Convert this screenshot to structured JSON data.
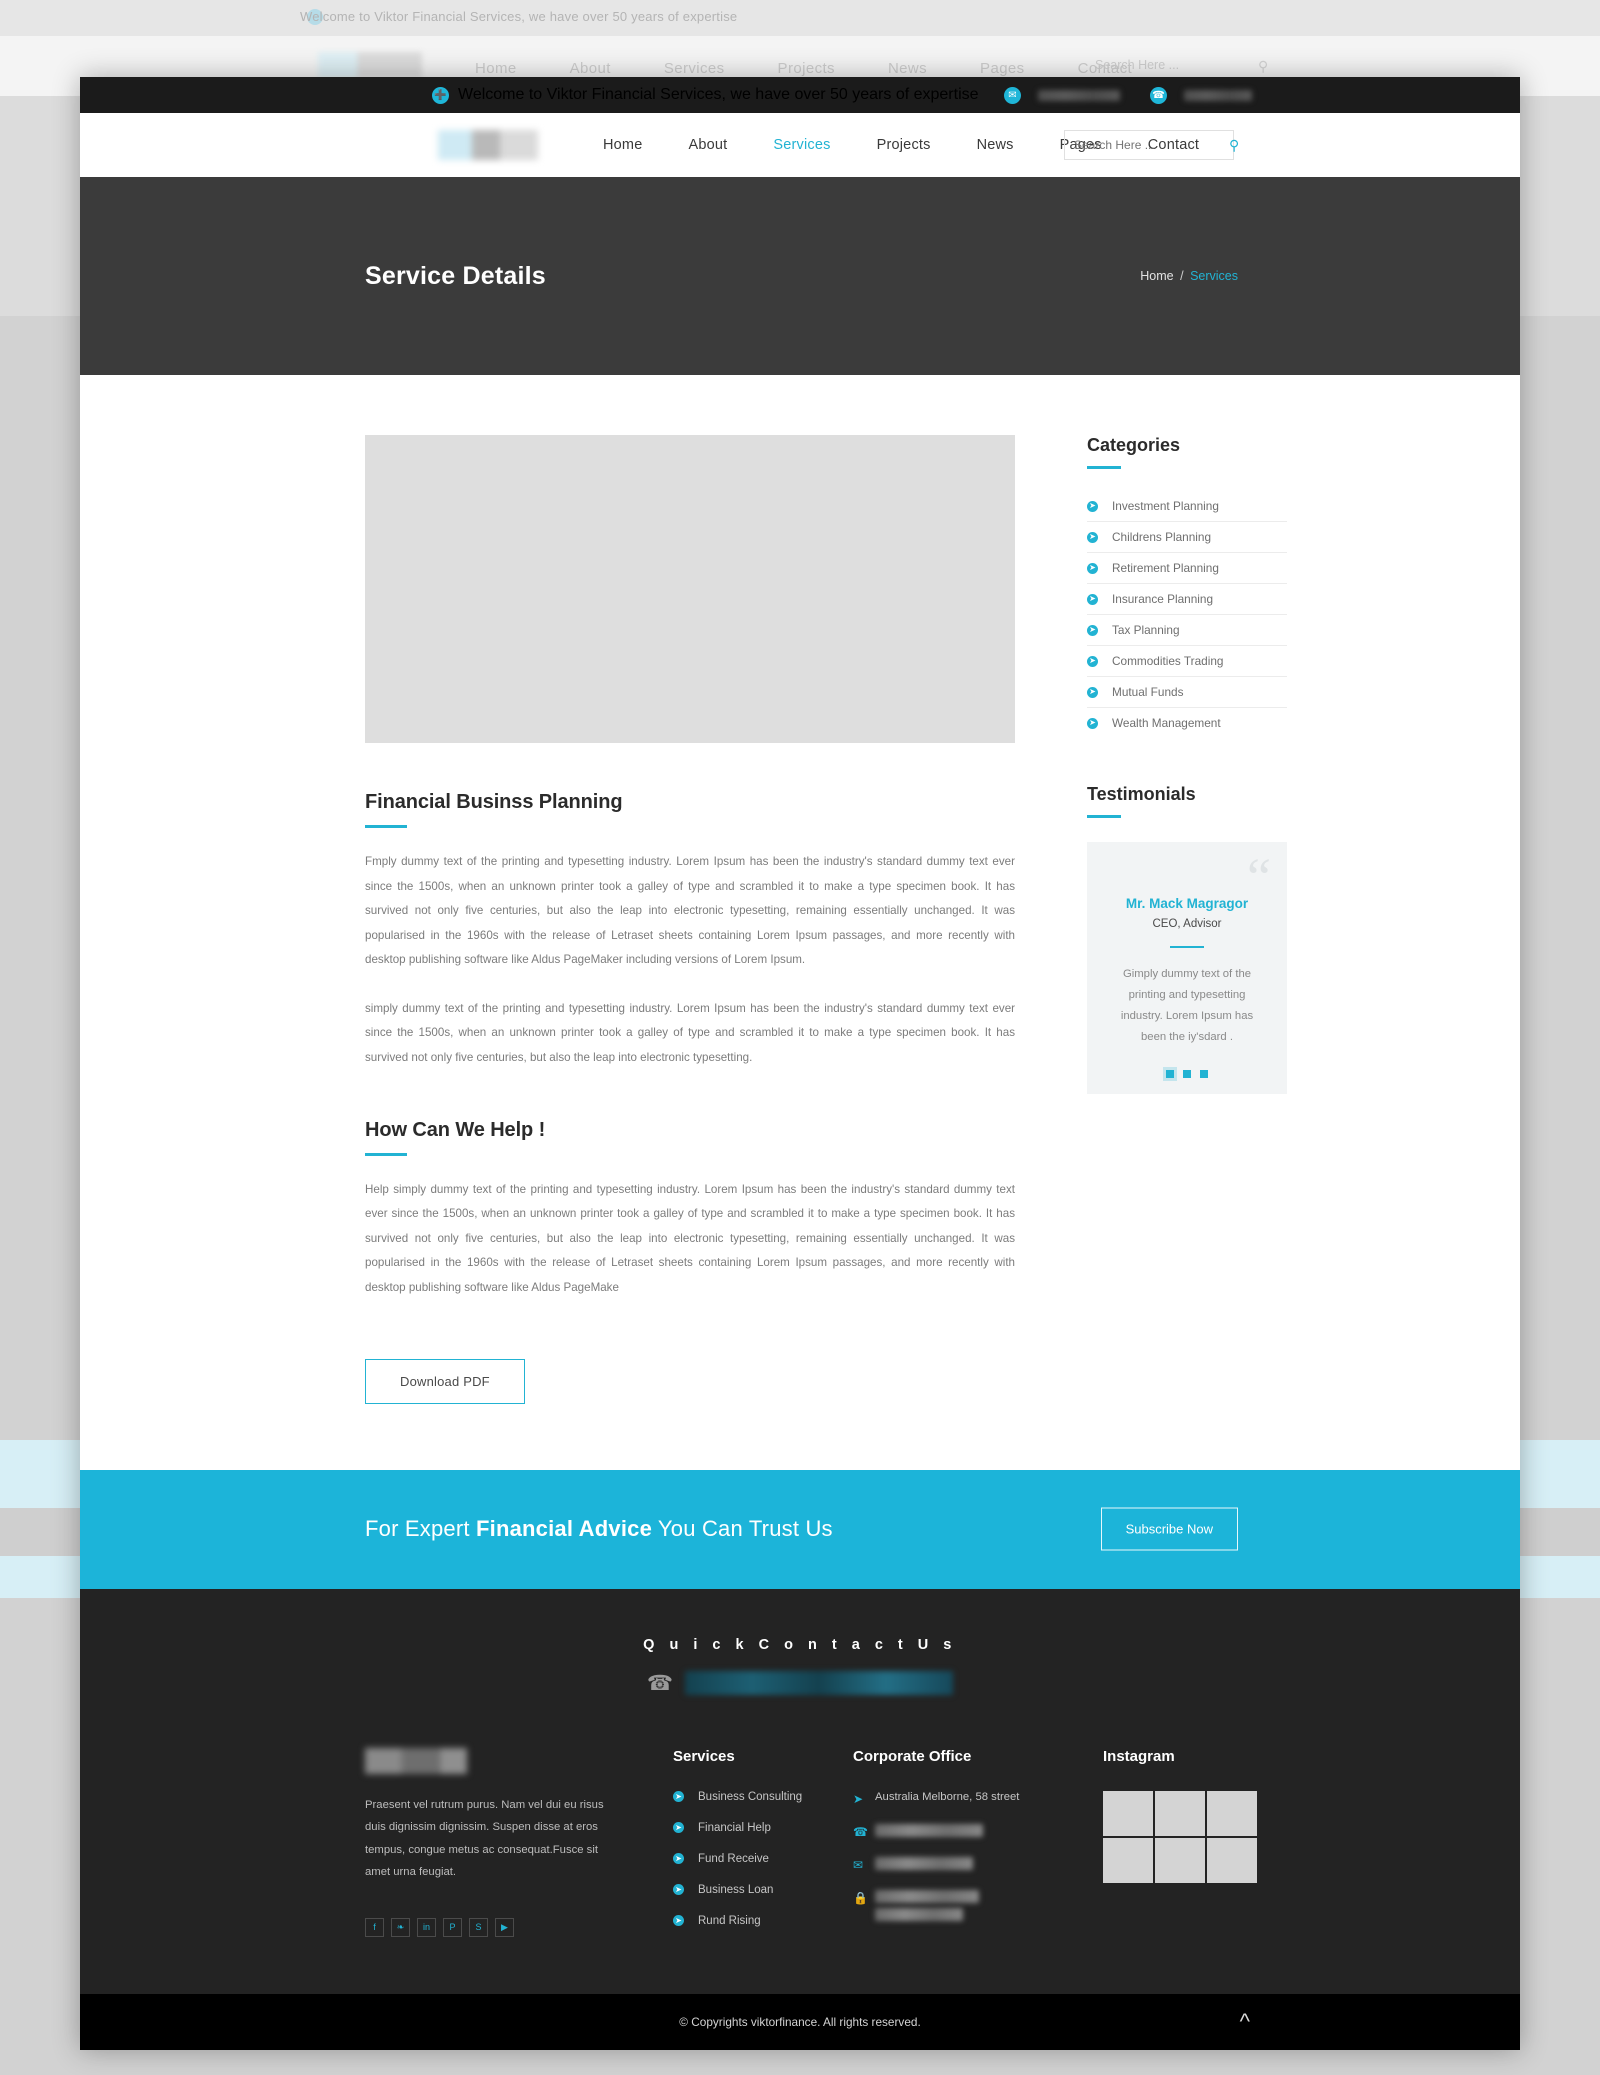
{
  "ghost": {
    "topbar_message": "Welcome to Viktor  Financial Services, we have over 50 years of expertise",
    "nav": [
      "Home",
      "About",
      "Services",
      "Projects",
      "News",
      "Pages",
      "Contact"
    ],
    "search_placeholder": "Search Here ..."
  },
  "topbar": {
    "message": "Welcome to Viktor  Financial Services, we have over 50 years of expertise",
    "plus_icon": "plus-circle-icon",
    "email_icon": "envelope-icon",
    "phone_icon": "phone-icon",
    "email_value": "",
    "phone_value": ""
  },
  "header": {
    "logo_alt": "viktorfinance-logo",
    "nav": [
      {
        "label": "Home",
        "active": false
      },
      {
        "label": "About",
        "active": false
      },
      {
        "label": "Services",
        "active": true
      },
      {
        "label": "Projects",
        "active": false
      },
      {
        "label": "News",
        "active": false
      },
      {
        "label": "Pages",
        "active": false
      },
      {
        "label": "Contact",
        "active": false
      }
    ],
    "search_placeholder": "Search Here ...",
    "search_value": "",
    "search_icon": "search-icon"
  },
  "hero": {
    "title": "Service Details",
    "breadcrumb_home": "Home",
    "breadcrumb_sep": "/",
    "breadcrumb_current": "Services"
  },
  "main": {
    "feature_image_alt": "service-feature-image",
    "heading_1": "Financial Businss Planning",
    "paragraph_1": "Fmply dummy text of the printing and typesetting industry. Lorem Ipsum has been the industry's standard dummy text ever since the 1500s, when an unknown printer took a galley of type and scrambled it to make a type specimen book. It has survived not only five centuries, but also the leap into electronic typesetting, remaining essentially unchanged. It was popularised in the 1960s with the release of Letraset sheets containing Lorem Ipsum passages, and more recently with desktop publishing software like Aldus PageMaker including versions of Lorem Ipsum.",
    "paragraph_2": " simply dummy text of the printing and typesetting industry. Lorem Ipsum has been the industry's standard dummy text ever since the 1500s, when an unknown printer took a galley of type and scrambled it to make a type specimen book. It has survived not only five centuries, but also the leap into electronic typesetting.",
    "heading_2": "How Can We Help !",
    "paragraph_3": "Help simply dummy text of the printing and typesetting industry. Lorem Ipsum has been the industry's standard dummy text ever since the 1500s, when an unknown printer took a galley of type and scrambled it to make a type specimen book. It has survived not only five centuries, but also the leap into electronic typesetting, remaining essentially unchanged. It was popularised in the 1960s with the release of Letraset sheets containing Lorem Ipsum passages, and more recently with desktop publishing software like Aldus PageMake",
    "download_button": "Download PDF"
  },
  "sidebar": {
    "categories_title": "Categories",
    "categories": [
      "Investment Planning",
      "Childrens Planning",
      "Retirement Planning",
      "Insurance Planning",
      "Tax Planning",
      "Commodities Trading",
      "Mutual Funds",
      "Wealth Management"
    ],
    "testimonials_title": "Testimonials",
    "testimonial": {
      "name": "Mr. Mack Magragor",
      "role": "CEO, Advisor",
      "text": "Gimply dummy text of the printing and typesetting industry. Lorem Ipsum has been the iy'sdard .",
      "slides": 3,
      "active_slide": 1
    }
  },
  "cta": {
    "text_pre": "For Expert ",
    "text_bold": "Financial Advice",
    "text_post": " You Can Trust Us",
    "button": "Subscribe Now"
  },
  "footer": {
    "quick_contact_title": "Q u i c k   C o n t a c t   U s",
    "quick_contact_phone": "",
    "phone_icon": "phone-icon",
    "about": {
      "logo_alt": "viktorfinance-footer-logo",
      "description": "Praesent vel rutrum purus. Nam vel dui eu risus duis dignissim dignissim. Suspen disse at eros tempus, congue metus ac consequat.Fusce sit amet urna feugiat.",
      "socials": [
        {
          "name": "facebook-icon",
          "glyph": "f"
        },
        {
          "name": "twitter-icon",
          "glyph": "❧"
        },
        {
          "name": "linkedin-icon",
          "glyph": "in"
        },
        {
          "name": "pinterest-icon",
          "glyph": "P"
        },
        {
          "name": "skype-icon",
          "glyph": "S"
        },
        {
          "name": "youtube-icon",
          "glyph": "▶"
        }
      ]
    },
    "services": {
      "title": "Services",
      "items": [
        "Business Consulting",
        "Financial Help",
        "Fund Receive",
        "Business Loan",
        "Rund Rising"
      ]
    },
    "office": {
      "title": "Corporate Office",
      "address": "Australia Melborne, 58 street",
      "address_icon": "paper-plane-icon",
      "phone": "",
      "phone_icon": "phone-icon",
      "email": "",
      "email_icon": "envelope-icon",
      "website": "",
      "website_icon": "lock-icon"
    },
    "instagram": {
      "title": "Instagram",
      "cells": 6
    },
    "copyright": "© Copyrights viktorfinance. All rights reserved.",
    "to_top_icon": "chevron-up-icon"
  },
  "colors": {
    "accent": "#22b3d3",
    "cta_band": "#1cb4d9",
    "hero_bg": "#3b3b3b",
    "footer_bg": "#232323",
    "topbar_bg": "#1b1b1b",
    "copyright_bg": "#000000"
  }
}
